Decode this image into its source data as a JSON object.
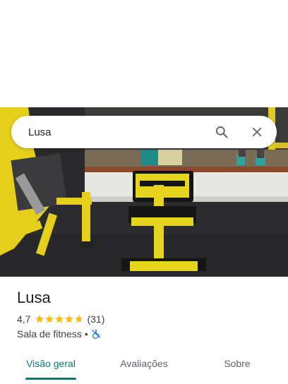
{
  "search": {
    "query": "Lusa"
  },
  "place": {
    "name": "Lusa",
    "rating": "4,7",
    "rating_value": 4.7,
    "review_count": "(31)",
    "category": "Sala de fitness",
    "separator": "•"
  },
  "tabs": [
    {
      "label": "Visão geral",
      "active": true
    },
    {
      "label": "Avaliações",
      "active": false
    },
    {
      "label": "Sobre",
      "active": false
    }
  ],
  "colors": {
    "accent": "#0b7a75",
    "star": "#fbbc04",
    "accessibility": "#1a73e8"
  },
  "icons": [
    "search-icon",
    "close-icon",
    "star-icon",
    "accessibility-icon"
  ]
}
